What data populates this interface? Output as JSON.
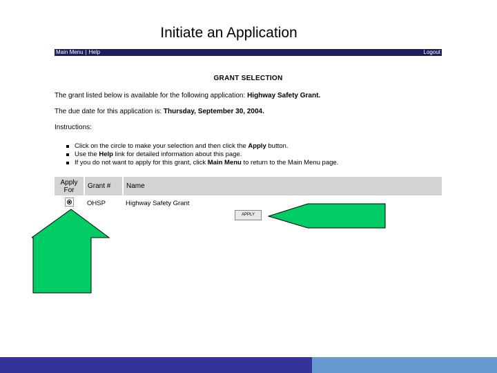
{
  "slide": {
    "title": "Initiate an Application"
  },
  "navbar": {
    "main_menu": "Main Menu",
    "separator": "|",
    "help": "Help",
    "logout": "Logout"
  },
  "page": {
    "heading": "GRANT SELECTION",
    "available_prefix": "The grant listed below is available for the following application:",
    "available_value": "Highway Safety Grant.",
    "due_prefix": "The due date for this application is:",
    "due_value": "Thursday, September 30, 2004.",
    "instructions_title": "Instructions:"
  },
  "instructions": {
    "b1_pre": "Click on the circle to make your selection and then click the ",
    "b1_bold": "Apply",
    "b1_post": " button.",
    "b2_pre": "Use the ",
    "b2_bold": "Help",
    "b2_post": " link for detailed information about this page.",
    "b3_pre": "If you do not want to apply for this grant, click ",
    "b3_bold": "Main Menu",
    "b3_post": " to return to the Main Menu page."
  },
  "table": {
    "headers": {
      "apply_line1": "Apply",
      "apply_line2": "For",
      "grant_no": "Grant #",
      "name": "Name"
    },
    "rows": [
      {
        "grant_no": "OHSP",
        "name": "Highway Safety Grant",
        "selected": true
      }
    ]
  },
  "apply_button": {
    "label": "APPLY"
  },
  "colors": {
    "navbar": "#1c1c5e",
    "header_bg": "#d3d3d3",
    "arrow_fill": "#00cc66",
    "footer_left": "#34339a",
    "footer_right": "#6799d1"
  }
}
